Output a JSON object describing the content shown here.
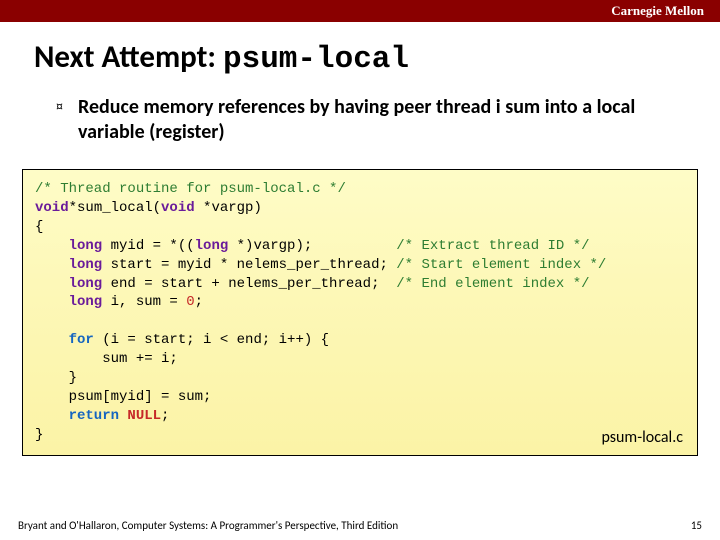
{
  "brand": "Carnegie Mellon",
  "title_prefix": "Next Attempt: ",
  "title_code": "psum-local",
  "bullet1": "Reduce memory references by having peer thread i sum into a local variable (register)",
  "code": {
    "l1_a": "/* Thread routine for psum-local.c */",
    "l2_a": "void",
    "l2_b": "*sum_local(",
    "l2_c": "void",
    "l2_d": " *vargp) ",
    "l3": "{ ",
    "l4_a": "    long",
    "l4_b": " myid = *((",
    "l4_c": "long",
    "l4_d": " *)vargp);          ",
    "l4_e": "/* Extract thread ID */",
    "l5_a": "    long",
    "l5_b": " start = myid * nelems_per_thread; ",
    "l5_c": "/* Start element index */",
    "l6_a": "    long",
    "l6_b": " end = start + nelems_per_thread;  ",
    "l6_c": "/* End element index */",
    "l7_a": "    long",
    "l7_b": " i, sum = ",
    "l7_c": "0",
    "l7_d": "; ",
    "l8": " ",
    "l9_a": "    for",
    "l9_b": " (i = start; i < end; i++) { ",
    "l10": "        sum += i; ",
    "l11": "    } ",
    "l12": "    psum[myid] = sum;",
    "l13_a": "    return",
    "l13_b": " NULL",
    "l13_c": "; ",
    "l14": "} "
  },
  "filelabel": "psum-local.c",
  "footer_left": "Bryant and O'Hallaron, Computer Systems: A Programmer's Perspective, Third Edition",
  "footer_right": "15"
}
